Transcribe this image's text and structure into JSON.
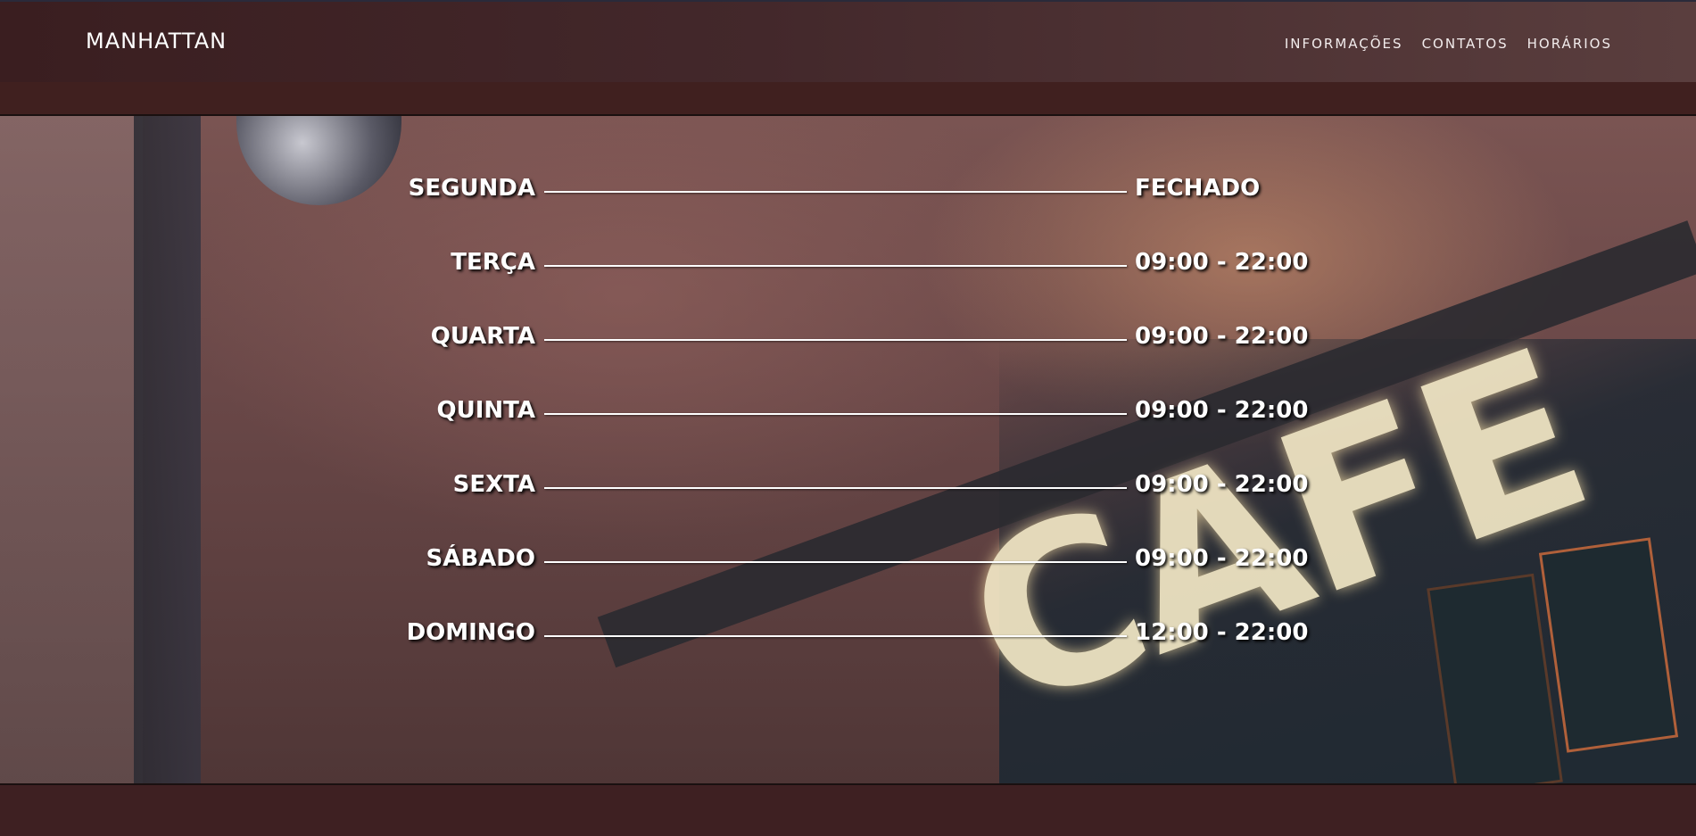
{
  "header": {
    "brand": "MANHATTAN",
    "nav": [
      {
        "label": "INFORMAÇÕES"
      },
      {
        "label": "CONTATOS"
      },
      {
        "label": "HORÁRIOS"
      }
    ]
  },
  "hero": {
    "sign_text": "CAFE",
    "hours": [
      {
        "day": "SEGUNDA",
        "time": "FECHADO"
      },
      {
        "day": "TERÇA",
        "time": "09:00 - 22:00"
      },
      {
        "day": "QUARTA",
        "time": "09:00 - 22:00"
      },
      {
        "day": "QUINTA",
        "time": "09:00 - 22:00"
      },
      {
        "day": "SEXTA",
        "time": "09:00 - 22:00"
      },
      {
        "day": "SÁBADO",
        "time": "09:00 - 22:00"
      },
      {
        "day": "DOMINGO",
        "time": "12:00 - 22:00"
      }
    ]
  },
  "colors": {
    "header_bg": "#43282b",
    "page_bg": "#3e2022",
    "text": "#ffffff"
  }
}
